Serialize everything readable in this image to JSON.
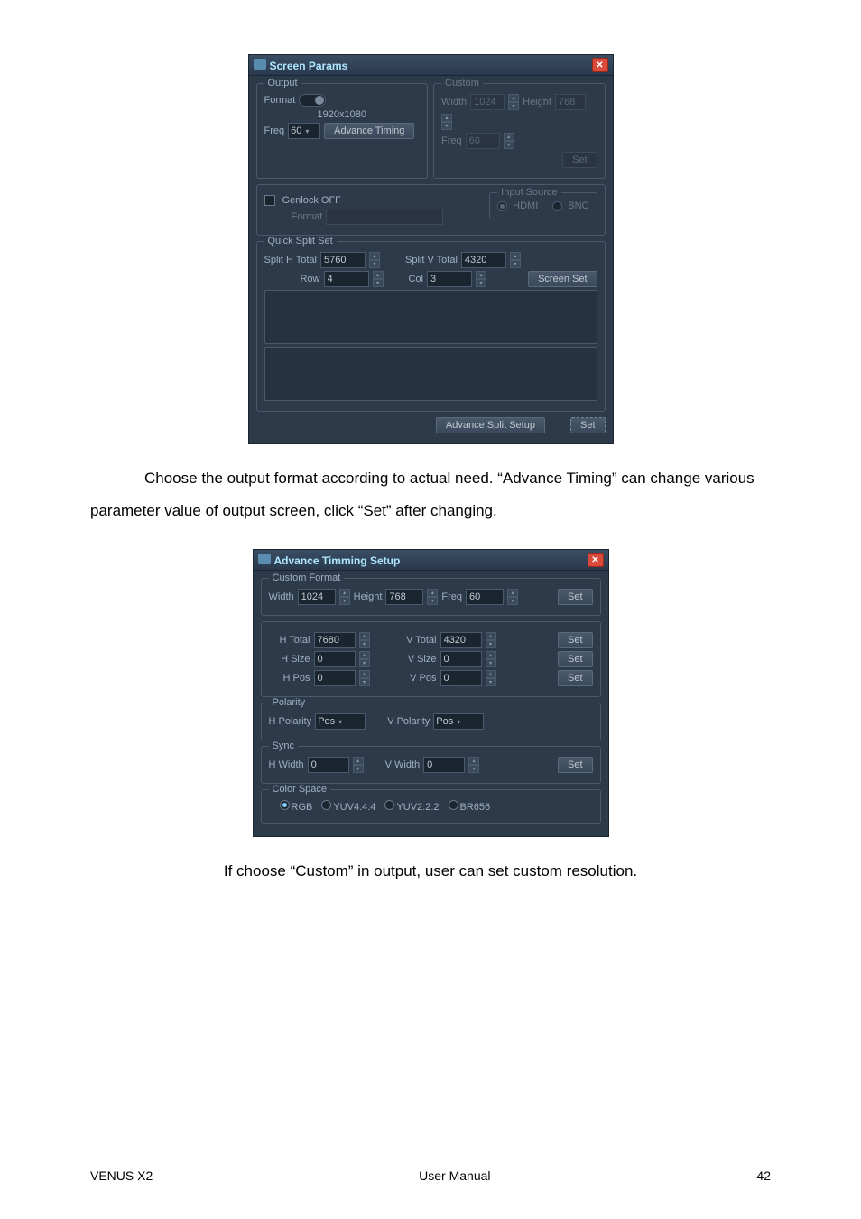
{
  "dialog_screen": {
    "title": "Screen Params",
    "output": {
      "legend": "Output",
      "format_label": "Format",
      "format_value": "1920x1080",
      "freq_label": "Freq",
      "freq_value": "60",
      "advance_timing_btn": "Advance Timing"
    },
    "custom": {
      "legend": "Custom",
      "width_label": "Width",
      "width_value": "1024",
      "height_label": "Height",
      "height_value": "768",
      "freq_label": "Freq",
      "freq_value": "60",
      "set_btn": "Set"
    },
    "genlock": {
      "off_label": "Genlock OFF",
      "format_label": "Format",
      "format_value": "",
      "input_source_legend": "Input Source",
      "hdmi_label": "HDMI",
      "bnc_label": "BNC"
    },
    "quick_split": {
      "legend": "Quick Split Set",
      "split_h_label": "Split H Total",
      "split_h_value": "5760",
      "split_v_label": "Split V Total",
      "split_v_value": "4320",
      "row_label": "Row",
      "row_value": "4",
      "col_label": "Col",
      "col_value": "3",
      "screen_set_btn": "Screen Set"
    },
    "adv_split_btn": "Advance Split Setup",
    "set_btn": "Set"
  },
  "caption1": "Choose the output format according to actual need. “Advance Timing” can change various parameter value of output screen, click “Set” after changing.",
  "dialog_timing": {
    "title": "Advance Timming Setup",
    "custom_fmt": {
      "legend": "Custom Format",
      "width_label": "Width",
      "width_value": "1024",
      "height_label": "Height",
      "height_value": "768",
      "freq_label": "Freq",
      "freq_value": "60",
      "set_btn": "Set"
    },
    "totals": {
      "h_total_label": "H Total",
      "h_total_value": "7680",
      "v_total_label": "V Total",
      "v_total_value": "4320",
      "h_size_label": "H Size",
      "h_size_value": "0",
      "v_size_label": "V Size",
      "v_size_value": "0",
      "h_pos_label": "H Pos",
      "h_pos_value": "0",
      "v_pos_label": "V Pos",
      "v_pos_value": "0",
      "set_btn": "Set"
    },
    "polarity": {
      "legend": "Polarity",
      "h_pol_label": "H Polarity",
      "h_pol_value": "Pos",
      "v_pol_label": "V Polarity",
      "v_pol_value": "Pos"
    },
    "sync": {
      "legend": "Sync",
      "h_width_label": "H Width",
      "h_width_value": "0",
      "v_width_label": "V Width",
      "v_width_value": "0",
      "set_btn": "Set"
    },
    "color_space": {
      "legend": "Color Space",
      "rgb": "RGB",
      "yuv444": "YUV4:4:4",
      "yuv222": "YUV2:2:2",
      "br656": "BR656"
    }
  },
  "caption2": "If choose “Custom” in output, user can set custom resolution.",
  "footer": {
    "left": "VENUS X2",
    "center": "User Manual",
    "right": "42"
  }
}
